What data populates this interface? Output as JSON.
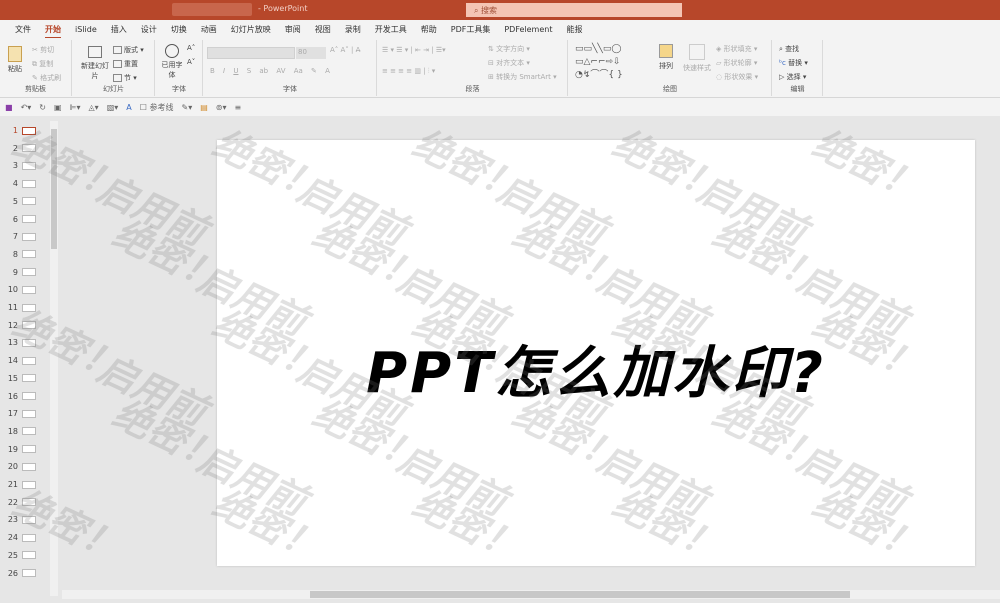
{
  "title_bar": {
    "app_name": "- PowerPoint",
    "search_placeholder": "搜索"
  },
  "tabs": [
    "文件",
    "开始",
    "iSlide",
    "插入",
    "设计",
    "切换",
    "动画",
    "幻灯片放映",
    "审阅",
    "视图",
    "录制",
    "开发工具",
    "帮助",
    "PDF工具集",
    "PDFelement",
    "能报"
  ],
  "active_tab": "开始",
  "ribbon": {
    "clipboard": {
      "paste": "粘贴",
      "cut": "剪切",
      "copy": "复制",
      "format_painter": "格式刷",
      "label": "剪贴板"
    },
    "slides": {
      "new_slide": "新建幻灯片",
      "layout": "版式",
      "reset": "重置",
      "section": "节",
      "label": "幻灯片"
    },
    "fontgroup": {
      "used_fonts": "已用字体",
      "label": "字体"
    },
    "font": {
      "size": "80",
      "label": "字体",
      "bold": "B",
      "italic": "I",
      "underline": "U",
      "strike": "S"
    },
    "paragraph": {
      "text_direction": "文字方向",
      "align_text": "对齐文本",
      "smartart": "转换为 SmartArt",
      "label": "段落"
    },
    "drawing": {
      "arrange": "排列",
      "quick_styles": "快速样式",
      "shape_fill": "形状填充",
      "shape_outline": "形状轮廓",
      "shape_effects": "形状效果",
      "label": "绘图"
    },
    "editing": {
      "find": "查找",
      "replace": "替换",
      "select": "选择",
      "label": "编辑"
    }
  },
  "qat": {
    "guides": "参考线"
  },
  "thumbnails": [
    "1",
    "2",
    "3",
    "4",
    "5",
    "6",
    "7",
    "8",
    "9",
    "10",
    "11",
    "12",
    "13",
    "14",
    "15",
    "16",
    "17",
    "18",
    "19",
    "20",
    "21",
    "22",
    "23",
    "24",
    "25",
    "26"
  ],
  "selected_slide": "1",
  "slide": {
    "title": "PPT怎么加水印?"
  },
  "watermark": {
    "text_a": "绝密！",
    "text_b": "启用前"
  },
  "colors": {
    "accent": "#b7472a"
  }
}
